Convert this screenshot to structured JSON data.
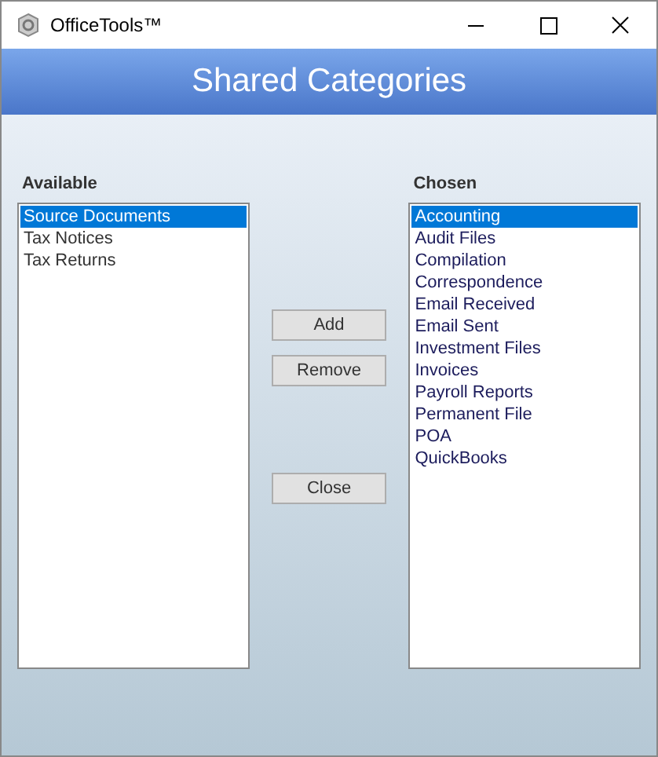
{
  "window": {
    "title": "OfficeTools™"
  },
  "header": {
    "title": "Shared Categories"
  },
  "available": {
    "label": "Available",
    "items": [
      {
        "text": "Source Documents",
        "selected": true
      },
      {
        "text": "Tax Notices",
        "selected": false
      },
      {
        "text": "Tax Returns",
        "selected": false
      }
    ]
  },
  "buttons": [
    "Add",
    "Remove",
    "Close"
  ],
  "chosen": {
    "label": "Chosen",
    "items": [
      {
        "text": "Accounting",
        "selected": true
      },
      {
        "text": "Audit Files",
        "selected": false
      },
      {
        "text": "Compilation",
        "selected": false
      },
      {
        "text": "Correspondence",
        "selected": false
      },
      {
        "text": "Email Received",
        "selected": false
      },
      {
        "text": "Email Sent",
        "selected": false
      },
      {
        "text": "Investment Files",
        "selected": false
      },
      {
        "text": "Invoices",
        "selected": false
      },
      {
        "text": "Payroll Reports",
        "selected": false
      },
      {
        "text": "Permanent File",
        "selected": false
      },
      {
        "text": "POA",
        "selected": false
      },
      {
        "text": "QuickBooks",
        "selected": false
      }
    ]
  }
}
